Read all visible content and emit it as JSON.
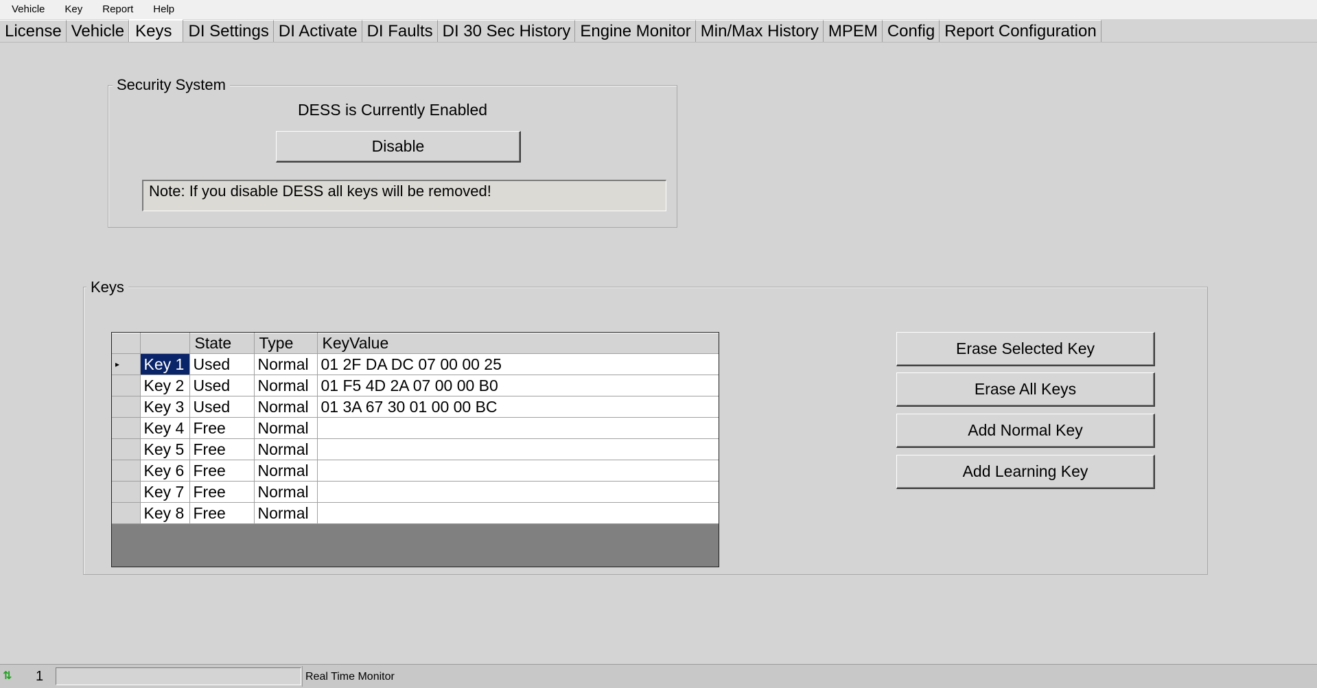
{
  "menu": [
    "Vehicle",
    "Key",
    "Report",
    "Help"
  ],
  "tabs": [
    {
      "label": "License",
      "active": false
    },
    {
      "label": "Vehicle",
      "active": false
    },
    {
      "label": "Keys",
      "active": true
    },
    {
      "label": "DI Settings",
      "active": false
    },
    {
      "label": "DI Activate",
      "active": false
    },
    {
      "label": "DI Faults",
      "active": false
    },
    {
      "label": "DI 30 Sec History",
      "active": false
    },
    {
      "label": "Engine Monitor",
      "active": false
    },
    {
      "label": "Min/Max History",
      "active": false
    },
    {
      "label": "MPEM",
      "active": false
    },
    {
      "label": "Config",
      "active": false
    },
    {
      "label": "Report Configuration",
      "active": false
    }
  ],
  "security": {
    "legend": "Security System",
    "status": "DESS is Currently Enabled",
    "disable_label": "Disable",
    "note": "Note: If you disable DESS all keys will be removed!"
  },
  "keys": {
    "legend": "Keys",
    "columns": [
      "",
      "",
      "State",
      "Type",
      "KeyValue"
    ],
    "rows": [
      {
        "name": "Key 1",
        "state": "Used",
        "type": "Normal",
        "value": "01 2F DA DC 07 00 00 25",
        "selected": true
      },
      {
        "name": "Key 2",
        "state": "Used",
        "type": "Normal",
        "value": "01 F5 4D 2A 07 00 00 B0",
        "selected": false
      },
      {
        "name": "Key 3",
        "state": "Used",
        "type": "Normal",
        "value": "01 3A 67 30 01 00 00 BC",
        "selected": false
      },
      {
        "name": "Key 4",
        "state": "Free",
        "type": "Normal",
        "value": "",
        "selected": false
      },
      {
        "name": "Key 5",
        "state": "Free",
        "type": "Normal",
        "value": "",
        "selected": false
      },
      {
        "name": "Key 6",
        "state": "Free",
        "type": "Normal",
        "value": "",
        "selected": false
      },
      {
        "name": "Key 7",
        "state": "Free",
        "type": "Normal",
        "value": "",
        "selected": false
      },
      {
        "name": "Key 8",
        "state": "Free",
        "type": "Normal",
        "value": "",
        "selected": false
      }
    ],
    "current_row_marker": "▸",
    "buttons": {
      "erase_selected": "Erase Selected  Key",
      "erase_all": "Erase All Keys",
      "add_normal": "Add Normal Key",
      "add_learning": "Add Learning Key"
    }
  },
  "statusbar": {
    "arrows_icon": "transfer-arrows-icon",
    "arrows_glyph": "⇅",
    "count": "1",
    "label": "Real Time Monitor"
  },
  "colors": {
    "selection": "#0a246a",
    "status_arrows": "#1fa21f"
  }
}
